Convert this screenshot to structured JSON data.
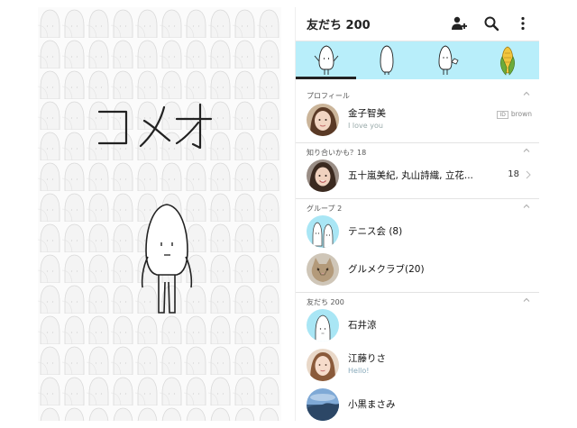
{
  "preview": {
    "title_glyph": "コメオ"
  },
  "header": {
    "title": "友だち 200"
  },
  "tabs": [
    {
      "icon": "rice-character-waving-icon"
    },
    {
      "icon": "rice-character-back-icon"
    },
    {
      "icon": "rice-character-holding-icon"
    },
    {
      "icon": "corn-icon"
    }
  ],
  "sections": {
    "profile": {
      "label": "プロフィール",
      "name": "金子智美",
      "status": "I love you",
      "id_box": "ID",
      "id_value": "brown"
    },
    "suggested": {
      "label": "知り合いかも？18",
      "names": "五十嵐美紀, 丸山詩織, 立花...",
      "count": "18"
    },
    "groups": {
      "label": "グループ 2",
      "items": [
        {
          "name": "テニス会 (8)"
        },
        {
          "name": "グルメクラブ(20)"
        }
      ]
    },
    "friends": {
      "label": "友だち 200",
      "items": [
        {
          "name": "石井涼",
          "status": ""
        },
        {
          "name": "江藤りさ",
          "status": "Hello!"
        },
        {
          "name": "小黒まさみ",
          "status": ""
        }
      ]
    }
  },
  "colors": {
    "tab_bar": "#b8eefa",
    "avatar_blue": "#a9e6f5"
  }
}
